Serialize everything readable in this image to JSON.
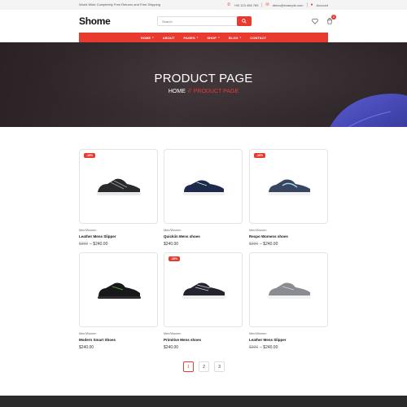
{
  "topbar": {
    "promo": "World Wide Completely Free Returns and Free Shipping",
    "phone": "+00 123 456 789",
    "email": "demo@example.com",
    "account": "Account"
  },
  "brand": "Shome",
  "search": {
    "placeholder": "Search"
  },
  "cart": {
    "count": "0"
  },
  "nav": [
    {
      "label": "HOME"
    },
    {
      "label": "ABOUT"
    },
    {
      "label": "PAGES"
    },
    {
      "label": "SHOP"
    },
    {
      "label": "BLOG"
    },
    {
      "label": "CONTACT"
    }
  ],
  "hero": {
    "title": "PRODUCT PAGE",
    "crumb_home": "HOME",
    "crumb_sep": "//",
    "crumb_current": "PRODUCT PAGE"
  },
  "products": [
    {
      "discount": "-10%",
      "category": "Men/Women",
      "title": "Leather Mens Slipper",
      "old_price": "$300",
      "price": "$240.00"
    },
    {
      "discount": "",
      "category": "Men/Women",
      "title": "Quickiin Mens shoes",
      "old_price": "",
      "price": "$240.00"
    },
    {
      "discount": "-10%",
      "category": "Men/Women",
      "title": "Rexpo Womens shoes",
      "old_price": "$300",
      "price": "$240.00"
    },
    {
      "discount": "",
      "category": "Men/Women",
      "title": "Modern Smart Shoes",
      "old_price": "",
      "price": "$240.00"
    },
    {
      "discount": "-10%",
      "category": "Men/Women",
      "title": "Primitive Mens shoes",
      "old_price": "",
      "price": "$240.00"
    },
    {
      "discount": "",
      "category": "Men/Women",
      "title": "Leather Mens Slipper",
      "old_price": "$300",
      "price": "$240.00"
    }
  ],
  "pagination": [
    "1",
    "2",
    "3"
  ],
  "icons": [
    "phone-icon",
    "mail-icon",
    "user-icon",
    "search-icon",
    "heart-icon",
    "cart-icon"
  ],
  "colors": {
    "accent": "#e83a2f",
    "hero_bg": "#2f2729",
    "footer": "#2b2b2b"
  }
}
